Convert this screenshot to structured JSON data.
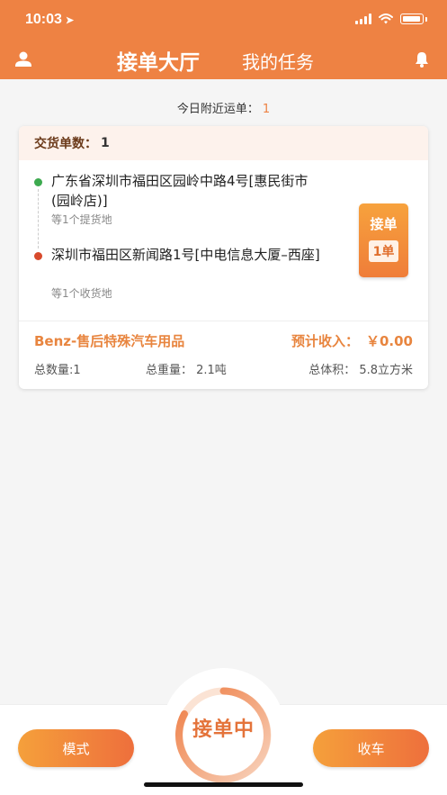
{
  "status_bar": {
    "time": "10:03",
    "location_arrow": "➤",
    "icons": [
      "signal-icon",
      "wifi-icon",
      "battery-icon"
    ]
  },
  "header": {
    "active_tab": "接单大厅",
    "tab": "我的任务",
    "left_icon": "user-icon",
    "right_icon": "bell-icon",
    "color": "#ee8243"
  },
  "summary": {
    "label": "今日附近运单：",
    "count": "1"
  },
  "order": {
    "head_label": "交货单数：",
    "head_value": "1",
    "pickup_address": "广东省深圳市福田区园岭中路4号[惠民街市(园岭店)]",
    "pickup_hint": "等1个提货地",
    "delivery_address": "深圳市福田区新闻路1号[中电信息大厦–西座]",
    "delivery_hint": "等1个收货地",
    "grab_label": "接单",
    "grab_count": "1单",
    "company": "Benz-售后特殊汽车用品",
    "income_label": "预计收入：",
    "income_value": "￥0.00",
    "total_qty": "总数量:1",
    "total_weight": "总重量：  2.1吨",
    "total_volume": "总体积：  5.8立方米"
  },
  "bottom": {
    "mode_label": "模式",
    "center_label": "接单中",
    "close_label": "收车"
  }
}
